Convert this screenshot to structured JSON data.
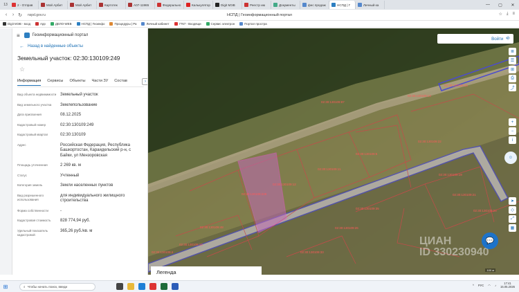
{
  "browser": {
    "tab_count": "13",
    "tabs": [
      {
        "label": "2 - Отправ",
        "color": "#d33"
      },
      {
        "label": "Мой Арбит",
        "color": "#a33"
      },
      {
        "label": "Мой Арбит",
        "color": "#a33"
      },
      {
        "label": "Картотек",
        "color": "#a33"
      },
      {
        "label": "А07-11965",
        "color": "#a33"
      },
      {
        "label": "Федерально",
        "color": "#c33"
      },
      {
        "label": "Калькулятор",
        "color": "#d22"
      },
      {
        "label": "Digit МЭВ",
        "color": "#222"
      },
      {
        "label": "Реестр ию",
        "color": "#c33"
      },
      {
        "label": "Документы",
        "color": "#4a8"
      },
      {
        "label": "фнс продаж",
        "color": "#58c"
      },
      {
        "label": "НСПД | Г",
        "color": "#2d7fc1"
      },
      {
        "label": "Личный ка",
        "color": "#58c"
      }
    ],
    "url": "nspd.gov.ru",
    "page_title": "НСПД | Геоинформационный портал",
    "bookmarks": [
      {
        "label": "Digit МЭВ - вход",
        "color": "#333"
      },
      {
        "label": "App",
        "color": "#c33"
      },
      {
        "label": "ДЕЛО-WEB",
        "color": "#3a6"
      },
      {
        "label": "НСПД | Геоинфо",
        "color": "#2d7fc1"
      },
      {
        "label": "Процедуры | Ра",
        "color": "#d83"
      },
      {
        "label": "Личный кабинет",
        "color": "#58c"
      },
      {
        "label": "7767 - Входящи",
        "color": "#d33"
      },
      {
        "label": "Сервис электрон",
        "color": "#3a6"
      },
      {
        "label": "Портал простра",
        "color": "#58c"
      }
    ]
  },
  "panel": {
    "portal_name": "Геоинформационный портал",
    "back_label": "Назад в найденные объекты",
    "object_title": "Земельный участок: 02:30:130109:249",
    "tabs": [
      "Информация",
      "Сервисы",
      "Объекты",
      "Части ЗУ",
      "Состав"
    ],
    "properties": [
      {
        "key": "Вид объекта недвижимости",
        "value": "Земельный участок"
      },
      {
        "key": "Вид земельного участка",
        "value": "Землепользование"
      },
      {
        "key": "Дата присвоения",
        "value": "08.12.2025"
      },
      {
        "key": "Кадастровый номер",
        "value": "02:30:130109:249"
      },
      {
        "key": "Кадастровый квартал",
        "value": "02:30:130109"
      },
      {
        "key": "Адрес",
        "value": "Российская Федерация, Республика Башкортостан, Караидельский р-н, с Байки, ул Мензоровская"
      },
      {
        "key": "Площадь уточненная",
        "value": "2 269 кв. м"
      },
      {
        "key": "Статус",
        "value": "Учтенный"
      },
      {
        "key": "Категория земель",
        "value": "Земли населенных пунктов"
      },
      {
        "key": "Вид разрешенного использования",
        "value": "для индивидуального жилищного строительства"
      },
      {
        "key": "Форма собственности",
        "value": "-"
      },
      {
        "key": "Кадастровая стоимость",
        "value": "828 774,94 руб."
      },
      {
        "key": "Удельный показатель кадастровой",
        "value": "365,26 руб./кв. м"
      }
    ]
  },
  "map": {
    "login_label": "Войти",
    "legend_label": "Легенда",
    "watermark": "ЦИАН\nID 330230940",
    "scale_label": "100 м"
  },
  "taskbar": {
    "search_placeholder": "Чтобы начать поиск, введи",
    "time": "17:41",
    "date": "15.05.2026",
    "lang": "РУС"
  }
}
